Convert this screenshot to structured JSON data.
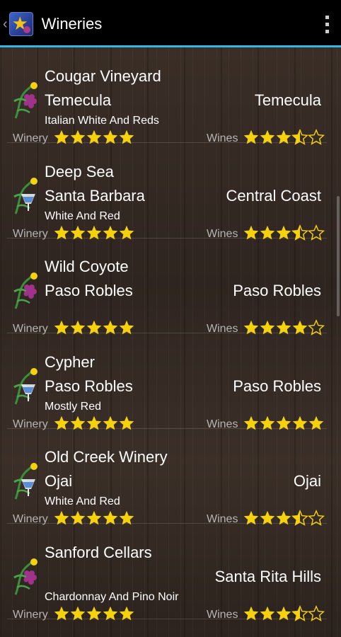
{
  "app": {
    "title": "Wineries",
    "icons": {
      "up": "chevron-left-icon",
      "app": "star-grape-app-icon",
      "overflow": "overflow-menu-icon"
    }
  },
  "colors": {
    "star": "#f5d20b",
    "accent": "#33b5e5",
    "text": "#ffffff",
    "muted": "#b5b5b5"
  },
  "wineries": [
    {
      "name": "Cougar Vineyard",
      "city": "Temecula",
      "region": "Temecula",
      "description": "Italian White And Reds",
      "winery_label": "Winery",
      "winery_rating": 5,
      "wines_label": "Wines",
      "wines_rating": 3.5,
      "icon": "grape-vine-icon"
    },
    {
      "name": "Deep Sea",
      "city": "Santa Barbara",
      "region": "Central Coast",
      "description": "White And Red",
      "winery_label": "Winery",
      "winery_rating": 5,
      "wines_label": "Wines",
      "wines_rating": 3.5,
      "icon": "wine-glass-vine-icon"
    },
    {
      "name": "Wild Coyote",
      "city": "Paso Robles",
      "region": "Paso Robles",
      "description": "",
      "winery_label": "Winery",
      "winery_rating": 5,
      "wines_label": "Wines",
      "wines_rating": 4,
      "icon": "grape-vine-icon"
    },
    {
      "name": "Cypher",
      "city": "Paso Robles",
      "region": "Paso Robles",
      "description": "Mostly Red",
      "winery_label": "Winery",
      "winery_rating": 5,
      "wines_label": "Wines",
      "wines_rating": 5,
      "icon": "wine-glass-vine-icon"
    },
    {
      "name": "Old Creek Winery",
      "city": "Ojai",
      "region": "Ojai",
      "description": "White And Red",
      "winery_label": "Winery",
      "winery_rating": 5,
      "wines_label": "Wines",
      "wines_rating": 3.5,
      "icon": "wine-glass-vine-icon"
    },
    {
      "name": "Sanford Cellars",
      "city": "",
      "region": "Santa Rita Hills",
      "description": "Chardonnay And Pino Noir",
      "winery_label": "Winery",
      "winery_rating": 5,
      "wines_label": "Wines",
      "wines_rating": 3.5,
      "icon": "grape-vine-icon"
    }
  ]
}
